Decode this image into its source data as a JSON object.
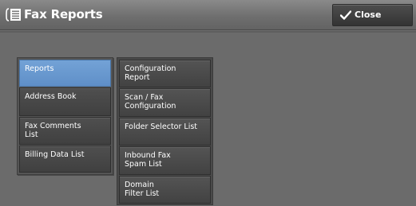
{
  "header": {
    "title": "Fax Reports",
    "icon": "report-list-icon",
    "close_label": "Close",
    "close_icon": "checkmark-icon"
  },
  "categories": [
    {
      "label": "Reports",
      "selected": true
    },
    {
      "label": "Address Book",
      "selected": false
    },
    {
      "label": "Fax Comments\nList",
      "selected": false
    },
    {
      "label": "Billing Data List",
      "selected": false
    }
  ],
  "reports": [
    {
      "label": "Configuration\nReport"
    },
    {
      "label": "Scan / Fax\nConfiguration"
    },
    {
      "label": "Folder Selector List"
    },
    {
      "label": "Inbound Fax\nSpam List"
    },
    {
      "label": "Domain\nFilter List"
    }
  ],
  "colors": {
    "selected_item": "#6a9bd2",
    "button_background": "#454545",
    "page_background": "#6b6b6b"
  }
}
